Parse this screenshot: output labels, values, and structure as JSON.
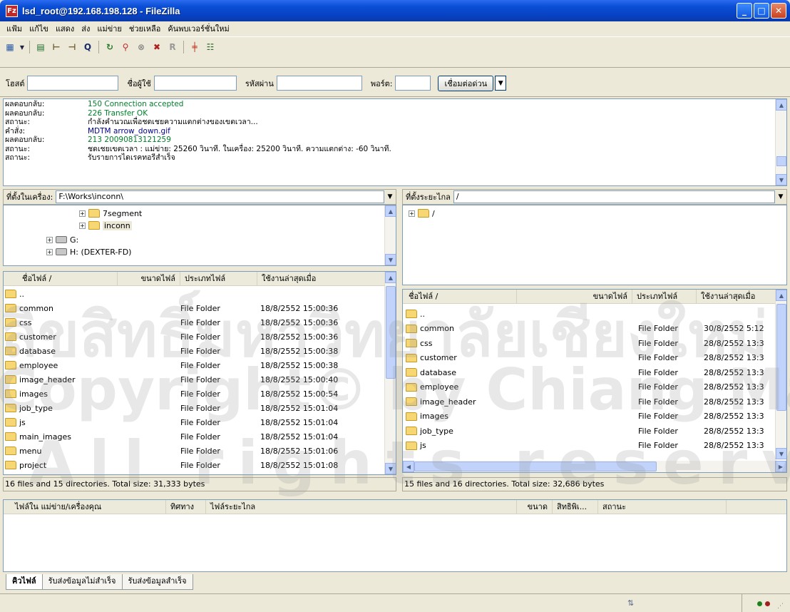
{
  "window": {
    "title": "lsd_root@192.168.198.128 - FileZilla",
    "app_icon": "Fz",
    "min": "_",
    "max": "□",
    "close": "✕"
  },
  "menu": [
    "แฟ้ม",
    "แก้ไข",
    "แสดง",
    "ส่ง",
    "แม่ข่าย",
    "ช่วยเหลือ",
    "ค้นพบเวอร์ชั่นใหม่"
  ],
  "quickconnect": {
    "host_label": "โฮสต์",
    "user_label": "ชื่อผู้ใช้",
    "pass_label": "รหัสผ่าน",
    "port_label": "พอร์ต:",
    "connect_label": "เชื่อมต่อด่วน",
    "host": "",
    "user": "",
    "pass": "",
    "port": ""
  },
  "log": [
    {
      "label": "ผลตอบกลับ:",
      "text": "150 Connection accepted",
      "color": "green"
    },
    {
      "label": "ผลตอบกลับ:",
      "text": "226 Transfer OK",
      "color": "green"
    },
    {
      "label": "สถานะ:",
      "text": "กำลังคำนวณเพื่อชดเชยความแตกต่างของเขตเวลา...",
      "color": "black"
    },
    {
      "label": "คำสั่ง:",
      "text": "MDTM arrow_down.gif",
      "color": "blue"
    },
    {
      "label": "ผลตอบกลับ:",
      "text": "213 20090813121259",
      "color": "green"
    },
    {
      "label": "สถานะ:",
      "text": "ชดเชยเขตเวลา : แม่ข่าย: 25260 วินาที. ในเครื่อง: 25200 วินาที. ความแตกต่าง: -60 วินาที.",
      "color": "black"
    },
    {
      "label": "สถานะ:",
      "text": "รับรายการไดเรคทอรีสำเร็จ",
      "color": "black"
    }
  ],
  "local": {
    "path_label": "ที่ตั้งในเครื่อง:",
    "path": "F:\\Works\\inconn\\",
    "tree": [
      {
        "text": "7segment",
        "type": "folder"
      },
      {
        "text": "inconn",
        "type": "folder"
      },
      {
        "text": "G:",
        "type": "drive"
      },
      {
        "text": "H: (DEXTER-FD)",
        "type": "drive"
      }
    ],
    "headers": [
      "ชื่อไฟล์  /",
      "ขนาดไฟล์",
      "ประเภทไฟล์",
      "ใช้งานล่าสุดเมื่อ"
    ],
    "rows": [
      {
        "name": "..",
        "type": "",
        "date": ""
      },
      {
        "name": "common",
        "type": "File Folder",
        "date": "18/8/2552 15:00:36"
      },
      {
        "name": "css",
        "type": "File Folder",
        "date": "18/8/2552 15:00:36"
      },
      {
        "name": "customer",
        "type": "File Folder",
        "date": "18/8/2552 15:00:36"
      },
      {
        "name": "database",
        "type": "File Folder",
        "date": "18/8/2552 15:00:38"
      },
      {
        "name": "employee",
        "type": "File Folder",
        "date": "18/8/2552 15:00:38"
      },
      {
        "name": "image_header",
        "type": "File Folder",
        "date": "18/8/2552 15:00:40"
      },
      {
        "name": "images",
        "type": "File Folder",
        "date": "18/8/2552 15:00:54"
      },
      {
        "name": "job_type",
        "type": "File Folder",
        "date": "18/8/2552 15:01:04"
      },
      {
        "name": "js",
        "type": "File Folder",
        "date": "18/8/2552 15:01:04"
      },
      {
        "name": "main_images",
        "type": "File Folder",
        "date": "18/8/2552 15:01:04"
      },
      {
        "name": "menu",
        "type": "File Folder",
        "date": "18/8/2552 15:01:06"
      },
      {
        "name": "project",
        "type": "File Folder",
        "date": "18/8/2552 15:01:08"
      }
    ],
    "status": "16 files and 15 directories. Total size: 31,333 bytes"
  },
  "remote": {
    "path_label": "ที่ตั้งระยะไกล",
    "path": "/",
    "tree": [
      {
        "text": "/",
        "type": "folder"
      }
    ],
    "headers": [
      "ชื่อไฟล์  /",
      "ขนาดไฟล์",
      "ประเภทไฟล์",
      "ใช้งานล่าสุดเมื่อ"
    ],
    "rows": [
      {
        "name": "..",
        "type": "",
        "date": ""
      },
      {
        "name": "common",
        "type": "File Folder",
        "date": "30/8/2552 5:12"
      },
      {
        "name": "css",
        "type": "File Folder",
        "date": "28/8/2552 13:3"
      },
      {
        "name": "customer",
        "type": "File Folder",
        "date": "28/8/2552 13:3"
      },
      {
        "name": "database",
        "type": "File Folder",
        "date": "28/8/2552 13:3"
      },
      {
        "name": "employee",
        "type": "File Folder",
        "date": "28/8/2552 13:3"
      },
      {
        "name": "image_header",
        "type": "File Folder",
        "date": "28/8/2552 13:3"
      },
      {
        "name": "images",
        "type": "File Folder",
        "date": "28/8/2552 13:3"
      },
      {
        "name": "job_type",
        "type": "File Folder",
        "date": "28/8/2552 13:3"
      },
      {
        "name": "js",
        "type": "File Folder",
        "date": "28/8/2552 13:3"
      }
    ],
    "status": "15 files and 16 directories. Total size: 32,686 bytes"
  },
  "queue": {
    "headers": [
      "ไฟล์ใน แม่ข่าย/เครื่องคุณ",
      "ทิศทาง",
      "ไฟล์ระยะไกล",
      "ขนาด",
      "สิทธิพิเ...",
      "สถานะ"
    ]
  },
  "tabs": [
    "คิวไฟล์",
    "รับส่งข้อมูลไม่สำเร็จ",
    "รับส่งข้อมูลสำเร็จ"
  ],
  "watermark": {
    "line1": "ลิขสิทธิ์มหาวิทยาลัยเชียงใหม่",
    "line2": "Copyright© by Chiang Mai University",
    "line3": "All rights reserved"
  }
}
